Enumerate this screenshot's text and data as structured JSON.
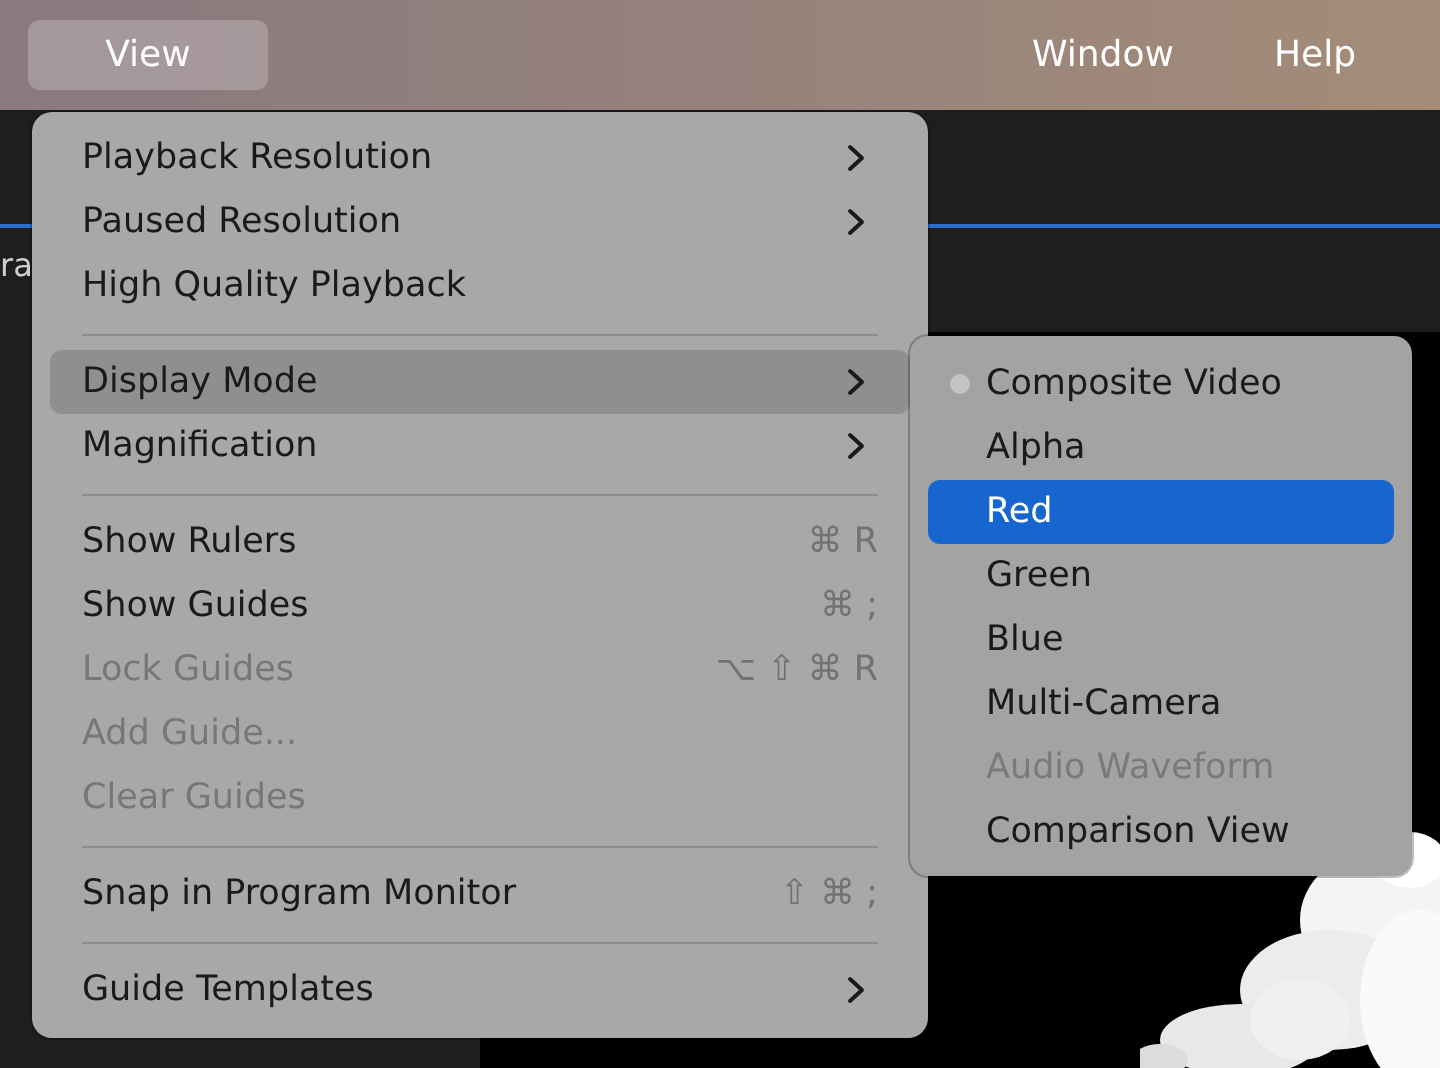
{
  "menu_bar": [
    {
      "label": "View",
      "selected": true
    },
    {
      "label": "Window",
      "selected": false
    },
    {
      "label": "Help",
      "selected": false
    }
  ],
  "background_label": "ra",
  "view_menu": [
    {
      "kind": "item",
      "label": "Playback Resolution",
      "submenu": true,
      "disabled": false,
      "selected": false
    },
    {
      "kind": "item",
      "label": "Paused Resolution",
      "submenu": true,
      "disabled": false,
      "selected": false
    },
    {
      "kind": "item",
      "label": "High Quality Playback",
      "submenu": false,
      "disabled": false,
      "selected": false
    },
    {
      "kind": "separator"
    },
    {
      "kind": "item",
      "label": "Display Mode",
      "submenu": true,
      "disabled": false,
      "selected": true
    },
    {
      "kind": "item",
      "label": "Magnification",
      "submenu": true,
      "disabled": false,
      "selected": false
    },
    {
      "kind": "separator"
    },
    {
      "kind": "item",
      "label": "Show Rulers",
      "shortcut": "⌘ R",
      "submenu": false,
      "disabled": false,
      "selected": false
    },
    {
      "kind": "item",
      "label": "Show Guides",
      "shortcut": "⌘ ;",
      "submenu": false,
      "disabled": false,
      "selected": false
    },
    {
      "kind": "item",
      "label": "Lock Guides",
      "shortcut": "⌥ ⇧ ⌘ R",
      "submenu": false,
      "disabled": true,
      "selected": false
    },
    {
      "kind": "item",
      "label": "Add Guide...",
      "submenu": false,
      "disabled": true,
      "selected": false
    },
    {
      "kind": "item",
      "label": "Clear Guides",
      "submenu": false,
      "disabled": true,
      "selected": false
    },
    {
      "kind": "separator"
    },
    {
      "kind": "item",
      "label": "Snap in Program Monitor",
      "shortcut": "⇧ ⌘ ;",
      "submenu": false,
      "disabled": false,
      "selected": false
    },
    {
      "kind": "separator"
    },
    {
      "kind": "item",
      "label": "Guide Templates",
      "submenu": true,
      "disabled": false,
      "selected": false
    }
  ],
  "display_mode_submenu": [
    {
      "label": "Composite Video",
      "checked": true,
      "selected": false,
      "disabled": false
    },
    {
      "label": "Alpha",
      "checked": false,
      "selected": false,
      "disabled": false
    },
    {
      "label": "Red",
      "checked": false,
      "selected": true,
      "disabled": false
    },
    {
      "label": "Green",
      "checked": false,
      "selected": false,
      "disabled": false
    },
    {
      "label": "Blue",
      "checked": false,
      "selected": false,
      "disabled": false
    },
    {
      "label": "Multi-Camera",
      "checked": false,
      "selected": false,
      "disabled": false
    },
    {
      "label": "Audio Waveform",
      "checked": false,
      "selected": false,
      "disabled": true
    },
    {
      "label": "Comparison View",
      "checked": false,
      "selected": false,
      "disabled": false
    }
  ]
}
